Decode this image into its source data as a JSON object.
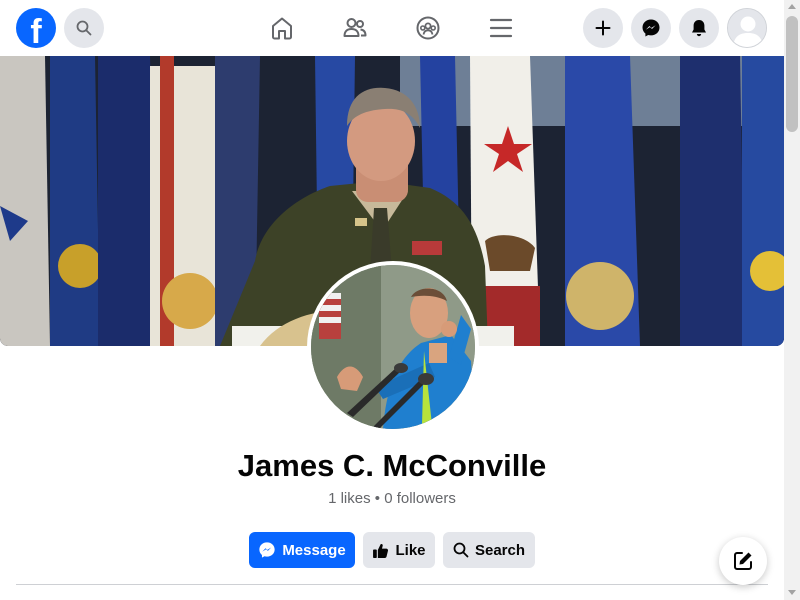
{
  "nav": {
    "logo_letter": "f",
    "logo_icon": "facebook-logo",
    "search_icon": "search-icon",
    "center_icons": [
      "home-icon",
      "friends-icon",
      "groups-icon",
      "menu-icon"
    ],
    "right_icons": [
      "plus-icon",
      "messenger-icon",
      "bell-icon",
      "avatar"
    ]
  },
  "profile": {
    "name": "James C. McConville",
    "stats": "1 likes • 0 followers",
    "cover_description_icon": "cover-photo",
    "picture_icon": "profile-picture"
  },
  "actions": {
    "message_label": "Message",
    "like_label": "Like",
    "search_label": "Search"
  },
  "colors": {
    "brand": "#0866ff",
    "button_gray": "#e4e6eb",
    "secondary_text": "#65676b"
  }
}
